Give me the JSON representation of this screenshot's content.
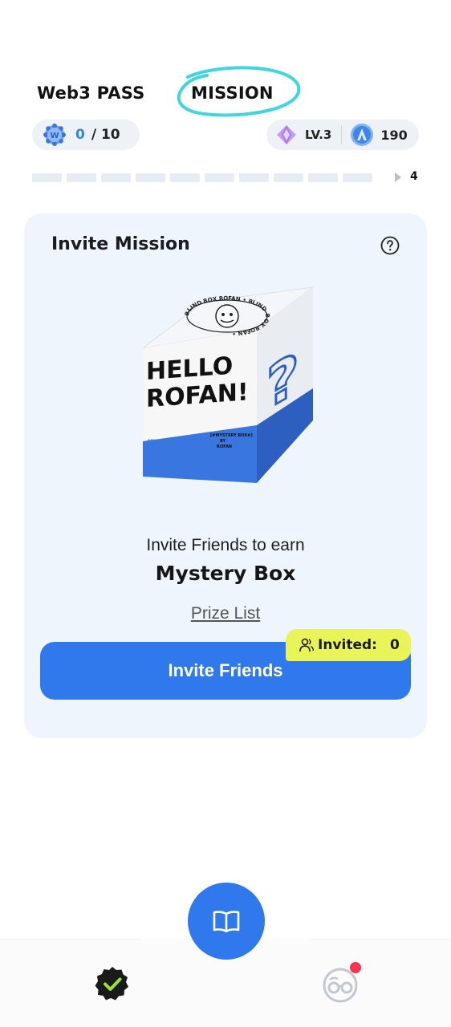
{
  "tabs": [
    {
      "label": "Web3 PASS"
    },
    {
      "label": "MISSION"
    }
  ],
  "progress": {
    "current": "0",
    "total_text": "/ 10",
    "segments": 10,
    "end_label": "4"
  },
  "level": {
    "label": "LV.3",
    "coins": "190"
  },
  "card": {
    "title": "Invite Mission",
    "box_art": {
      "line1": "HELLO",
      "line2": "ROFAN!",
      "side_label": "MYSTERY BOX",
      "side_sub": "RARE",
      "tag": "[#MYSTERY BOX#]",
      "tag_sub": "BY",
      "tag_brand": "ROFAN",
      "ring_text": "BLIND BOX ROFAN • BLIND BOX ROFAN •"
    },
    "invite_line": "Invite Friends to earn",
    "prize_name": "Mystery Box",
    "prize_list_link": "Prize List",
    "invite_button": "Invite Friends",
    "invited_label": "Invited:",
    "invited_count": "0"
  },
  "colors": {
    "accent": "#3079ec",
    "badge": "#e9f458",
    "mission_circle": "#3fd6e0",
    "card_bg": "#eef5fd"
  },
  "icons": [
    "gear-icon",
    "gem-icon",
    "coin-icon",
    "help-icon",
    "user-icon",
    "book-icon",
    "check-badge-icon",
    "glasses-icon"
  ]
}
